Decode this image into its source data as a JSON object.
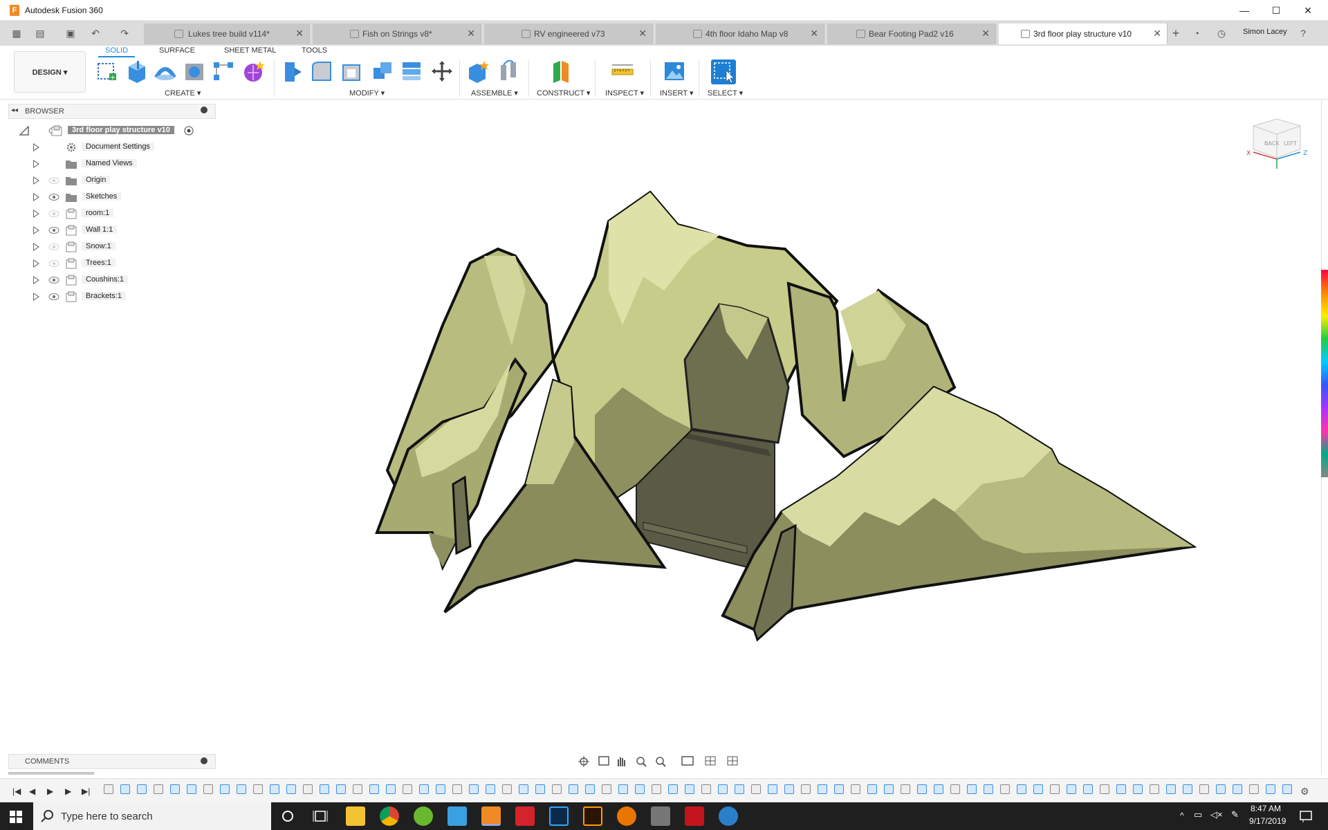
{
  "window": {
    "title": "Autodesk Fusion 360",
    "logo_letter": "F",
    "minimize": "—",
    "maximize": "☐",
    "close": "✕"
  },
  "tabs": [
    {
      "label": "Lukes tree build v114*",
      "close": "✕"
    },
    {
      "label": "Fish on Strings v8*",
      "close": "✕"
    },
    {
      "label": "RV engineered v73",
      "close": "✕"
    },
    {
      "label": "4th floor Idaho Map v8",
      "close": "✕"
    },
    {
      "label": "Bear Footing Pad2 v16",
      "close": "✕"
    },
    {
      "label": "3rd floor play structure v10",
      "close": "✕",
      "active": true
    }
  ],
  "user": {
    "name": "Simon Lacey"
  },
  "workspace": {
    "design_label": "DESIGN ▾"
  },
  "toolbar_tabs": [
    "SOLID",
    "SURFACE",
    "SHEET METAL",
    "TOOLS"
  ],
  "tool_groups": [
    "CREATE ▾",
    "MODIFY ▾",
    "ASSEMBLE ▾",
    "CONSTRUCT ▾",
    "INSPECT ▾",
    "INSERT ▾",
    "SELECT ▾"
  ],
  "browser": {
    "title": "BROWSER",
    "root": "3rd floor play structure v10",
    "items": [
      {
        "label": "Document Settings",
        "icon": "gear-icon",
        "eye": false
      },
      {
        "label": "Named Views",
        "icon": "folder-icon",
        "eye": false
      },
      {
        "label": "Origin",
        "icon": "folder-icon",
        "eye": "hidden"
      },
      {
        "label": "Sketches",
        "icon": "folder-icon",
        "eye": "visible"
      },
      {
        "label": "room:1",
        "icon": "component-icon",
        "eye": "hidden"
      },
      {
        "label": "Wall 1:1",
        "icon": "component-icon",
        "eye": "visible"
      },
      {
        "label": "Snow:1",
        "icon": "component-icon",
        "eye": "hidden"
      },
      {
        "label": "Trees:1",
        "icon": "component-icon",
        "eye": "hidden"
      },
      {
        "label": "Coushins:1",
        "icon": "component-icon",
        "eye": "visible"
      },
      {
        "label": "Brackets:1",
        "icon": "component-icon",
        "eye": "visible"
      }
    ]
  },
  "viewcube": {
    "back": "BACK",
    "left": "LEFT",
    "x": "X",
    "z": "Z"
  },
  "comments": {
    "title": "COMMENTS"
  },
  "taskbar": {
    "search_placeholder": "Type here to search",
    "time": "8:47 AM",
    "date": "9/17/2019"
  },
  "colors": {
    "accent": "#1d8fd8",
    "brand": "#f08a24",
    "taskbar": "#1f1f1f",
    "mountain_light": "#d3d69a",
    "mountain_mid": "#b4b87c",
    "mountain_dark": "#7b7c55",
    "floor": "#5a5a45"
  }
}
